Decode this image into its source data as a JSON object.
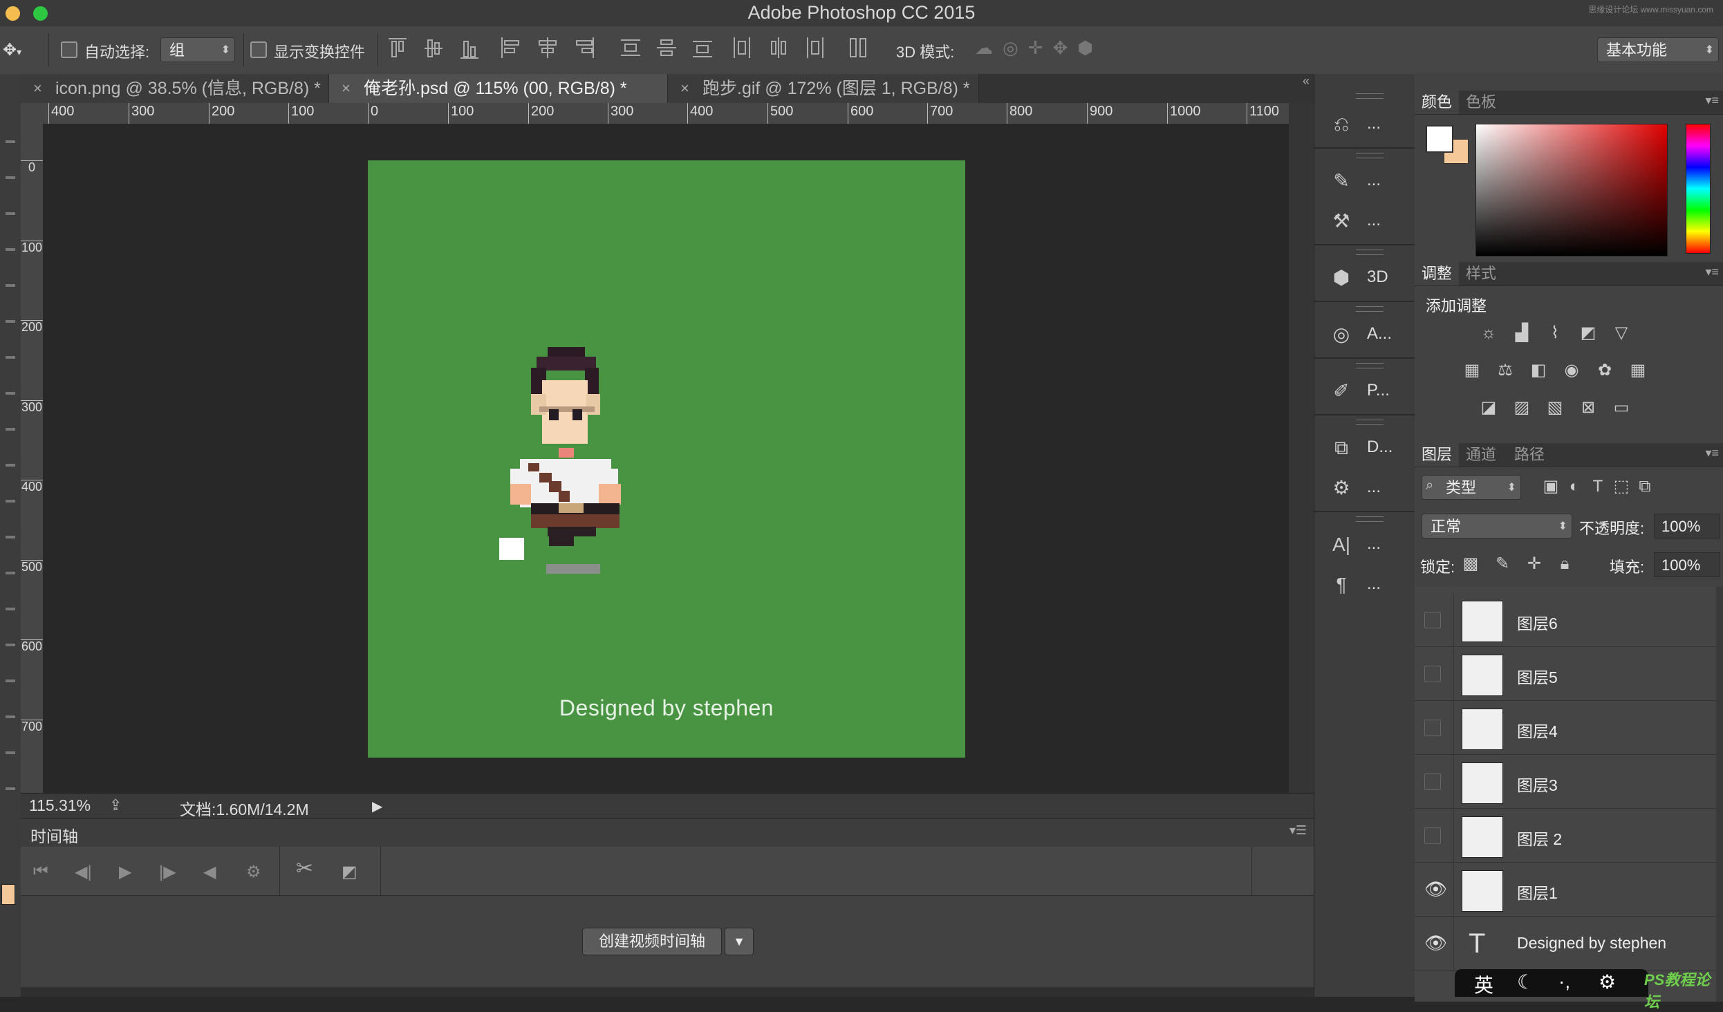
{
  "window": {
    "title": "Adobe Photoshop CC 2015",
    "watermark": "思缘设计论坛 www.missyuan.com"
  },
  "options_bar": {
    "auto_select_label": "自动选择:",
    "auto_select_value": "组",
    "show_transform_label": "显示变换控件",
    "mode_3d_label": "3D 模式:",
    "workspace_value": "基本功能"
  },
  "tabs": [
    {
      "label": "icon.png @ 38.5% (信息, RGB/8) *"
    },
    {
      "label": "俺老孙.psd @ 115% (00, RGB/8) *"
    },
    {
      "label": "跑步.gif @ 172% (图层 1, RGB/8) *"
    }
  ],
  "ruler": {
    "h": [
      "400",
      "300",
      "200",
      "100",
      "0",
      "100",
      "200",
      "300",
      "400",
      "500",
      "600",
      "700",
      "800",
      "900",
      "1000",
      "1100"
    ],
    "v": [
      "0",
      "100",
      "200",
      "300",
      "400",
      "500",
      "600",
      "700"
    ]
  },
  "canvas": {
    "credit": "Designed by stephen",
    "bg_color": "#489443"
  },
  "status": {
    "zoom": "115.31%",
    "doc_info": "文档:1.60M/14.2M"
  },
  "timeline": {
    "title": "时间轴",
    "create_button": "创建视频时间轴"
  },
  "dock": [
    {
      "icon": "history-icon",
      "label": "..."
    },
    {
      "icon": "brush-presets-icon",
      "label": "..."
    },
    {
      "icon": "tool-presets-icon",
      "label": "..."
    },
    {
      "icon": "3d-cube-icon",
      "label": "3D"
    },
    {
      "icon": "actions-icon",
      "label": "A..."
    },
    {
      "icon": "paths-icon",
      "label": "P..."
    },
    {
      "icon": "device-preview-icon",
      "label": "D..."
    },
    {
      "icon": "clone-source-icon",
      "label": "..."
    },
    {
      "icon": "character-icon",
      "label": "..."
    },
    {
      "icon": "paragraph-icon",
      "label": "..."
    }
  ],
  "panels": {
    "color_tabs": [
      "颜色",
      "色板"
    ],
    "adjust_tabs": [
      "调整",
      "样式"
    ],
    "adjust_title": "添加调整",
    "layer_tabs": [
      "图层",
      "通道",
      "路径"
    ],
    "filter_kind": "类型",
    "blend_mode": "正常",
    "opacity_label": "不透明度:",
    "opacity_value": "100%",
    "lock_label": "锁定:",
    "fill_label": "填充:",
    "fill_value": "100%"
  },
  "layers": [
    {
      "name": "图层6",
      "visible": false,
      "type": "image"
    },
    {
      "name": "图层5",
      "visible": false,
      "type": "image"
    },
    {
      "name": "图层4",
      "visible": false,
      "type": "image"
    },
    {
      "name": "图层3",
      "visible": false,
      "type": "image"
    },
    {
      "name": "图层 2",
      "visible": false,
      "type": "image"
    },
    {
      "name": "图层1",
      "visible": true,
      "type": "image"
    },
    {
      "name": "Designed by stephen",
      "visible": true,
      "type": "text"
    }
  ],
  "ime": {
    "lang": "英"
  },
  "site_watermark": "PS教程论坛"
}
